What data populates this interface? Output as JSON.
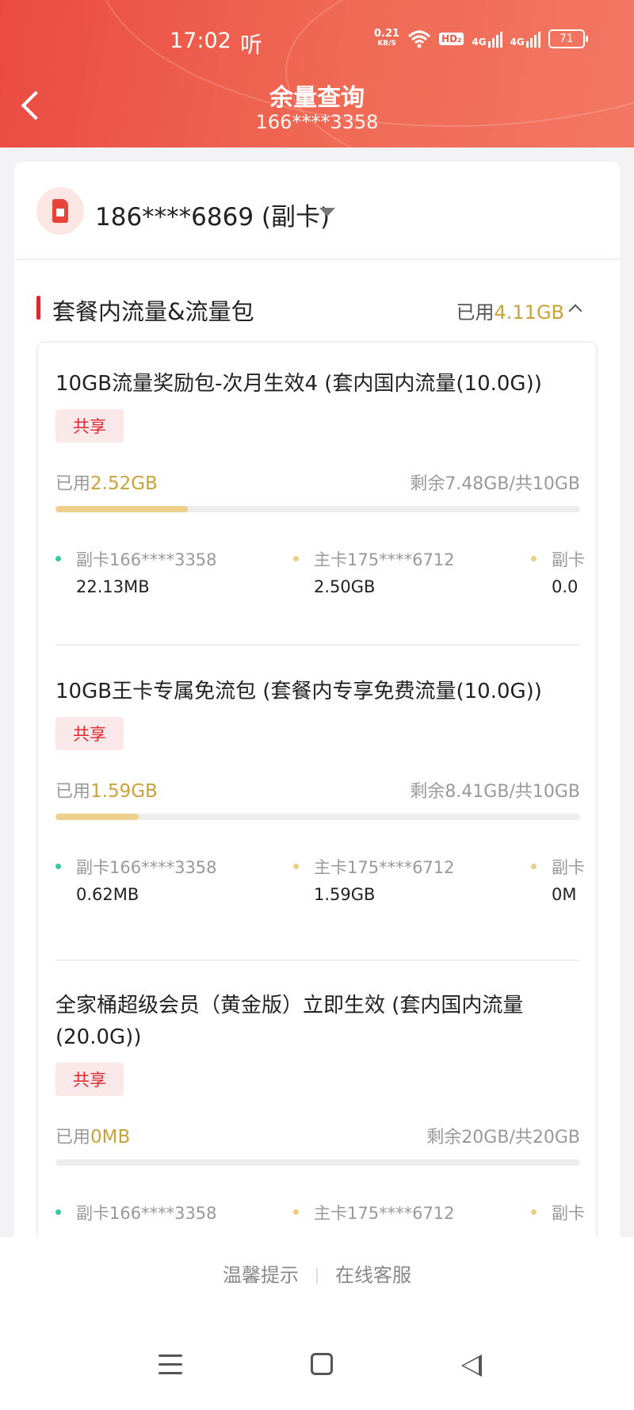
{
  "status_bar": {
    "time": "17:02",
    "listen_icon_text": "听",
    "net_speed": "0.21",
    "net_unit": "KB/S",
    "hd": "HD₂",
    "signal1": "4G",
    "signal2": "4G",
    "battery": "71"
  },
  "header": {
    "title": "余量查询",
    "subtitle": "166****3358"
  },
  "account": {
    "number": "186****6869 (副卡)"
  },
  "section": {
    "title": "套餐内流量&流量包",
    "used_label": "已用",
    "used_value": "4.11GB"
  },
  "packages": [
    {
      "name": "10GB流量奖励包-次月生效4 (套内国内流量(10.0G))",
      "tag": "共享",
      "used_label": "已用",
      "used_value": "2.52GB",
      "remaining": "剩余7.48GB/共10GB",
      "progress": 0.252,
      "members": [
        {
          "who": "副卡166****3358",
          "amount": "22.13MB",
          "dot": "#3cc9a0"
        },
        {
          "who": "主卡175****6712",
          "amount": "2.50GB",
          "dot": "#e8cf86"
        },
        {
          "who": "副卡",
          "amount": "0.0",
          "dot": "#e8cf86"
        }
      ]
    },
    {
      "name": "10GB王卡专属免流包 (套餐内专享免费流量(10.0G))",
      "tag": "共享",
      "used_label": "已用",
      "used_value": "1.59GB",
      "remaining": "剩余8.41GB/共10GB",
      "progress": 0.159,
      "members": [
        {
          "who": "副卡166****3358",
          "amount": "0.62MB",
          "dot": "#3cc9a0"
        },
        {
          "who": "主卡175****6712",
          "amount": "1.59GB",
          "dot": "#e8cf86"
        },
        {
          "who": "副卡",
          "amount": "0M",
          "dot": "#e8cf86"
        }
      ]
    },
    {
      "name": "全家桶超级会员（黄金版）立即生效 (套内国内流量(20.0G))",
      "tag": "共享",
      "used_label": "已用",
      "used_value": "0MB",
      "remaining": "剩余20GB/共20GB",
      "progress": 0,
      "members": [
        {
          "who": "副卡166****3358",
          "amount": "",
          "dot": "#3cc9a0"
        },
        {
          "who": "主卡175****6712",
          "amount": "",
          "dot": "#e8cf86"
        },
        {
          "who": "副卡",
          "amount": "",
          "dot": "#e8cf86"
        }
      ]
    }
  ],
  "footer": {
    "tips": "温馨提示",
    "service": "在线客服"
  },
  "nav_icons": [
    "menu-icon",
    "home-icon",
    "back-icon"
  ]
}
